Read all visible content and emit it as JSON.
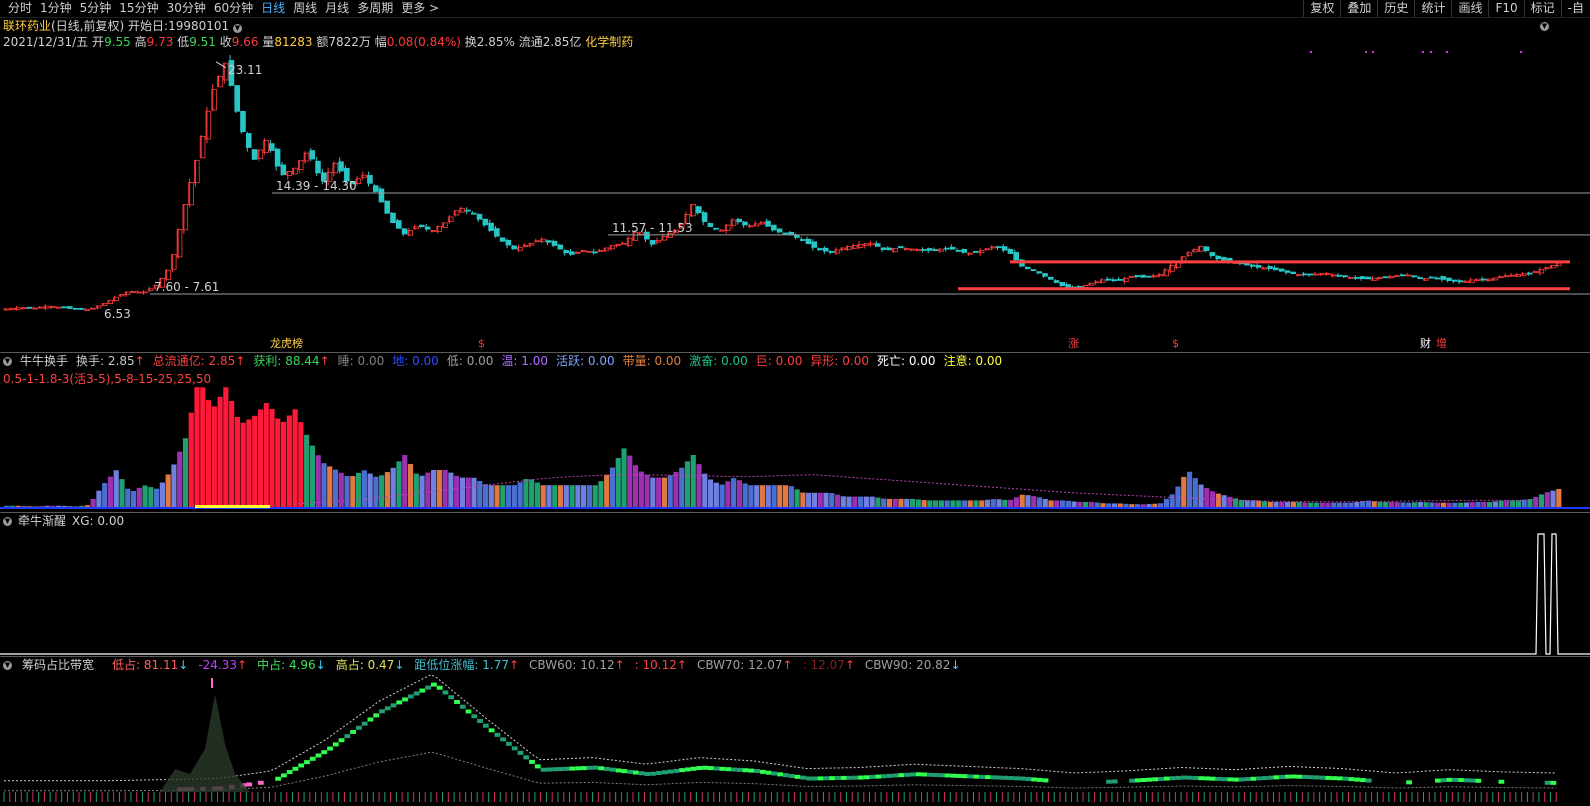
{
  "toolbar": {
    "periods": [
      "分时",
      "1分钟",
      "5分钟",
      "15分钟",
      "30分钟",
      "60分钟",
      "日线",
      "周线",
      "月线",
      "多周期",
      "更多 >"
    ],
    "active_period": "日线",
    "right_tools": [
      "复权",
      "叠加",
      "历史",
      "统计",
      "画线",
      "F10",
      "标记",
      "-自"
    ]
  },
  "stock": {
    "name": "联环药业",
    "mode": "(日线,前复权)",
    "start_label": "开始日:19980101",
    "date": "2021/12/31/五",
    "open_label": "开",
    "open": "9.55",
    "high_label": "高",
    "high": "9.73",
    "low_label": "低",
    "low": "9.51",
    "close_label": "收",
    "close": "9.66",
    "vol_label": "量",
    "vol": "81283",
    "amount": "额7822万",
    "chg_label": "幅",
    "chg": "0.08(0.84%)",
    "turnover": "换2.85%",
    "float": "流通2.85亿",
    "sector": "化学制药"
  },
  "main_chart": {
    "peak_label": "23.11",
    "low_label": "6.53",
    "levels": [
      {
        "label": "14.39 - 14.30",
        "value": 14.35
      },
      {
        "label": "11.57 - 11.53",
        "value": 11.55
      },
      {
        "label": "7.60 - 7.61",
        "value": 7.6
      }
    ],
    "price_range": [
      6.0,
      23.5
    ],
    "markers": [
      {
        "text": "龙虎榜",
        "color": "#ffd24d"
      },
      {
        "text": "$",
        "color": "#ff3b3b"
      },
      {
        "text": "涨",
        "color": "#ff3b3b"
      },
      {
        "text": "$",
        "color": "#ff3b3b"
      },
      {
        "text": "财",
        "color": "#ffffff"
      },
      {
        "text": "增",
        "color": "#ff3b3b"
      }
    ],
    "price_series": [
      6.6,
      6.7,
      6.65,
      6.8,
      6.7,
      6.6,
      6.55,
      6.9,
      7.4,
      7.8,
      7.7,
      8.2,
      9.5,
      13.5,
      17,
      21,
      23.1,
      19,
      16.5,
      18,
      15.5,
      16,
      17.2,
      15,
      16.4,
      14.8,
      15.6,
      14.3,
      12.5,
      11.6,
      12.2,
      11.8,
      12.4,
      13.4,
      13.0,
      12.1,
      11.2,
      10.6,
      10.9,
      11.3,
      10.8,
      10.2,
      10.5,
      10.4,
      10.8,
      11.0,
      11.9,
      10.9,
      11.5,
      12.0,
      13.6,
      12.2,
      11.8,
      12.6,
      12.1,
      12.4,
      11.8,
      11.6,
      11.2,
      10.6,
      10.4,
      10.7,
      10.9,
      11.0,
      10.5,
      10.7,
      10.6,
      10.5,
      10.6,
      10.6,
      10.3,
      10.5,
      10.8,
      10.4,
      9.4,
      9.1,
      8.6,
      8.1,
      8.0,
      8.3,
      8.6,
      8.5,
      8.8,
      8.7,
      8.9,
      9.6,
      10.3,
      10.8,
      10.0,
      9.8,
      9.6,
      9.4,
      9.3,
      9.1,
      8.9,
      8.9,
      9.0,
      8.8,
      8.7,
      8.6,
      8.7,
      8.8,
      8.9,
      8.6,
      8.7,
      8.5,
      8.4,
      8.6,
      8.6,
      8.8,
      8.9,
      9.0,
      9.3,
      9.66
    ]
  },
  "turnover_panel": {
    "title": "牛牛换手",
    "formula": "0.5-1-1.8-3(活3-5),5-8-15-25,25,50",
    "items": [
      {
        "label": "换手:",
        "value": "2.85",
        "arrow": "↑",
        "color": "#c8c8c8",
        "acolor": "#ff4040"
      },
      {
        "label": "总流通亿:",
        "value": "2.85",
        "arrow": "↑",
        "color": "#ff4040",
        "acolor": "#ff4040"
      },
      {
        "label": "获利:",
        "value": "88.44",
        "arrow": "↑",
        "color": "#3cd65a",
        "acolor": "#ff4040"
      },
      {
        "label": "睡:",
        "value": "0.00",
        "arrow": "",
        "color": "#808080",
        "acolor": "#808080"
      },
      {
        "label": "地:",
        "value": "0.00",
        "arrow": "",
        "color": "#2f4dff",
        "acolor": "#2f4dff"
      },
      {
        "label": "低:",
        "value": "0.00",
        "arrow": "",
        "color": "#a0a0a0",
        "acolor": "#a0a0a0"
      },
      {
        "label": "温:",
        "value": "1.00",
        "arrow": "",
        "color": "#b070ff",
        "acolor": "#b070ff"
      },
      {
        "label": "活跃:",
        "value": "0.00",
        "arrow": "",
        "color": "#7ea6ff",
        "acolor": "#7ea6ff"
      },
      {
        "label": "带量:",
        "value": "0.00",
        "arrow": "",
        "color": "#e08040",
        "acolor": "#e08040"
      },
      {
        "label": "激奋:",
        "value": "0.00",
        "arrow": "",
        "color": "#20c080",
        "acolor": "#20c080"
      },
      {
        "label": "巨:",
        "value": "0.00",
        "arrow": "",
        "color": "#ff4040",
        "acolor": "#ff4040"
      },
      {
        "label": "异形:",
        "value": "0.00",
        "arrow": "",
        "color": "#ff4040",
        "acolor": "#ff4040"
      },
      {
        "label": "死亡:",
        "value": "0.00",
        "arrow": "",
        "color": "#ffffff",
        "acolor": "#ffffff"
      },
      {
        "label": "注意:",
        "value": "0.00",
        "arrow": "",
        "color": "#ffff40",
        "acolor": "#ffff40"
      }
    ],
    "bar_series": [
      0.3,
      0.3,
      0.2,
      0.3,
      0.3,
      0.2,
      0.4,
      3,
      5,
      2,
      3,
      2.5,
      5,
      9,
      17,
      13,
      16,
      11,
      12,
      14,
      11,
      13,
      9,
      6,
      5,
      4,
      5,
      4,
      5,
      7,
      4,
      5,
      5,
      4,
      4,
      3,
      3,
      3,
      4,
      3,
      3,
      3,
      3,
      3,
      5,
      8,
      5,
      4,
      4,
      5,
      7,
      4,
      3,
      4,
      3,
      3,
      3,
      3,
      2,
      2,
      2,
      1.5,
      1.5,
      1.5,
      1.2,
      1.2,
      1.2,
      1,
      1,
      1,
      1,
      1,
      1.2,
      1,
      1.8,
      1.5,
      1,
      1,
      0.8,
      0.8,
      0.6,
      0.6,
      0.5,
      0.5,
      0.6,
      2,
      5,
      3,
      2,
      1.5,
      1,
      1,
      0.8,
      0.8,
      0.8,
      0.7,
      0.7,
      0.7,
      0.7,
      1,
      0.8,
      0.8,
      0.7,
      0.8,
      0.7,
      0.7,
      0.7,
      0.8,
      0.8,
      1,
      1,
      1.2,
      2,
      2.5
    ]
  },
  "xg_panel": {
    "title": "牵牛渐醒",
    "value_label": "XG: 0.00"
  },
  "chip_panel": {
    "title": "筹码占比带宽",
    "items": [
      {
        "label": "低占:",
        "value": "81.11",
        "arrow": "↓",
        "color": "#ff6060",
        "acolor": "#40d0ff"
      },
      {
        "label": "",
        "value": "-24.33",
        "arrow": "↑",
        "color": "#c040ff",
        "acolor": "#ff4040"
      },
      {
        "label": "中占:",
        "value": "4.96",
        "arrow": "↓",
        "color": "#40e060",
        "acolor": "#40d0ff"
      },
      {
        "label": "高占:",
        "value": "0.47",
        "arrow": "↓",
        "color": "#e0e060",
        "acolor": "#40d0ff"
      },
      {
        "label": "距低位涨幅:",
        "value": "1.77",
        "arrow": "↑",
        "color": "#40c0d0",
        "acolor": "#ff4040"
      },
      {
        "label": "CBW60:",
        "value": "10.12",
        "arrow": "↑",
        "color": "#a0a0a0",
        "acolor": "#ff4040"
      },
      {
        "label": ":",
        "value": "10.12",
        "arrow": "↑",
        "color": "#ff4040",
        "acolor": "#ff4040"
      },
      {
        "label": "CBW70:",
        "value": "12.07",
        "arrow": "↑",
        "color": "#a0a0a0",
        "acolor": "#ff4040"
      },
      {
        "label": ":",
        "value": "12.07",
        "arrow": "↑",
        "color": "#802020",
        "acolor": "#ff4040"
      },
      {
        "label": "CBW90:",
        "value": "20.82",
        "arrow": "↓",
        "color": "#a0a0a0",
        "acolor": "#40d0ff"
      }
    ]
  },
  "colors": {
    "up": "#ff3b3b",
    "down": "#29c6c6",
    "level": "#9a9a9a",
    "support": "#ff4040"
  }
}
